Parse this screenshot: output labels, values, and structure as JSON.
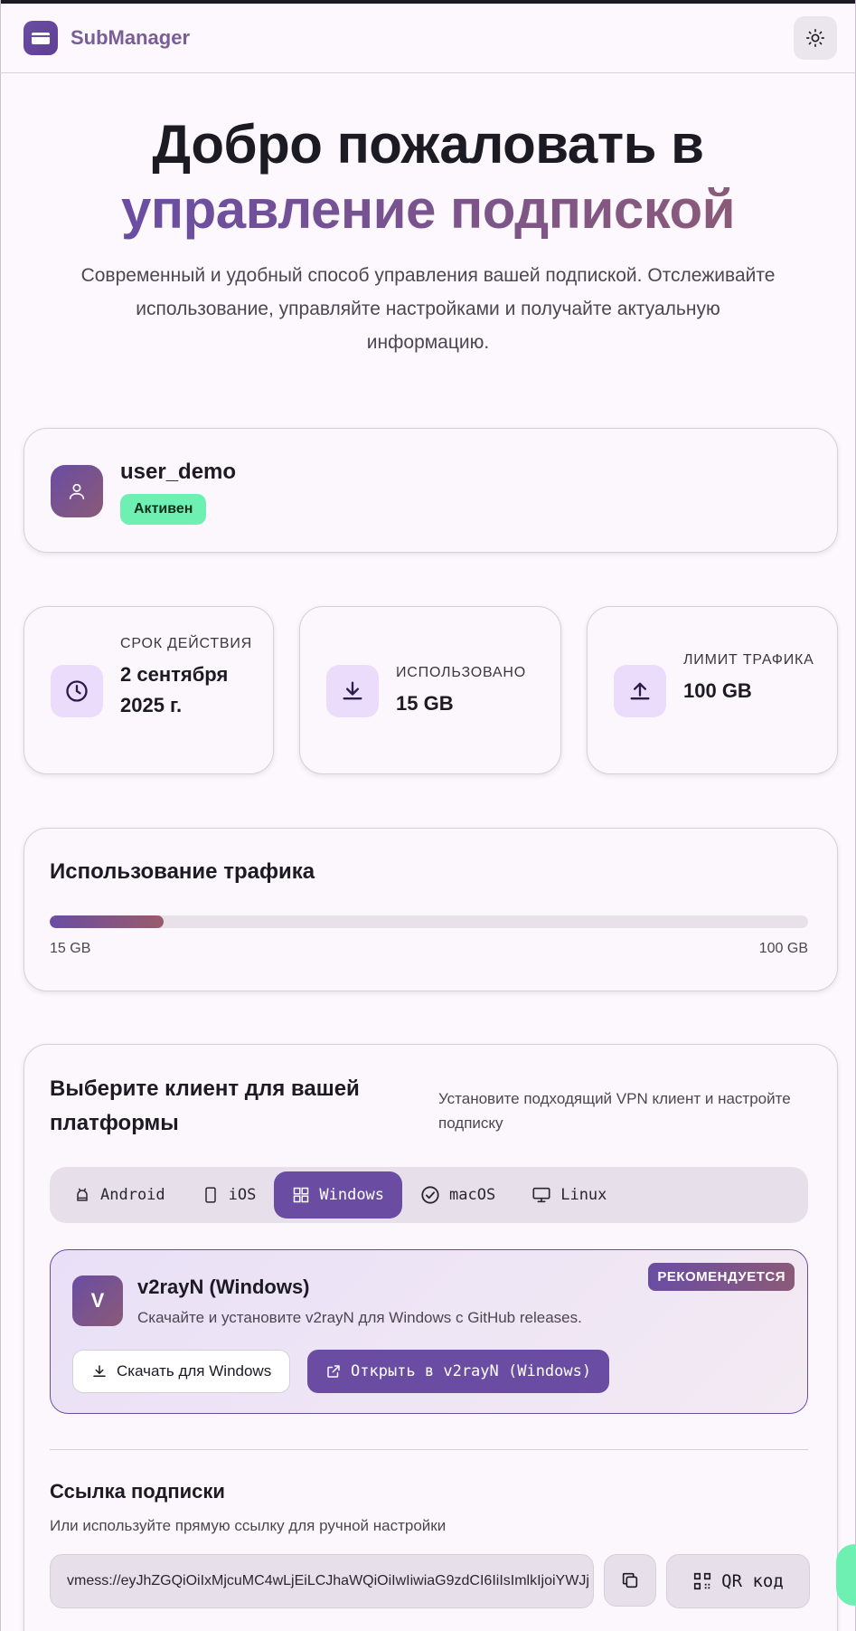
{
  "header": {
    "brand": "SubManager",
    "icons": {
      "logo": "card-icon",
      "theme": "sun-icon"
    }
  },
  "hero": {
    "title_line1": "Добро пожаловать в",
    "title_line2": "управление подпиской",
    "subtitle": "Современный и удобный способ управления вашей подпиской. Отслеживайте использование, управляйте настройками и получайте актуальную информацию."
  },
  "user": {
    "username": "user_demo",
    "status": "Активен",
    "status_color": "#6ff0b3"
  },
  "stats": [
    {
      "label": "Срок действия",
      "value": "2 сентября 2025 г.",
      "icon": "clock-icon"
    },
    {
      "label": "Использовано",
      "value": "15 GB",
      "icon": "download-icon"
    },
    {
      "label": "Лимит трафика",
      "value": "100 GB",
      "icon": "upload-icon"
    }
  ],
  "traffic": {
    "title": "Использование трафика",
    "used_label": "15 GB",
    "limit_label": "100 GB",
    "used_fraction": 0.15
  },
  "clients": {
    "title": "Выберите клиент для вашей платформы",
    "description": "Установите подходящий VPN клиент и настройте подписку",
    "tabs": [
      {
        "label": "Android",
        "icon": "android-icon",
        "active": false
      },
      {
        "label": "iOS",
        "icon": "phone-icon",
        "active": false
      },
      {
        "label": "Windows",
        "icon": "windows-icon",
        "active": true
      },
      {
        "label": "macOS",
        "icon": "apple-icon",
        "active": false
      },
      {
        "label": "Linux",
        "icon": "monitor-icon",
        "active": false
      }
    ],
    "selected": {
      "logo_letter": "V",
      "name": "v2rayN (Windows)",
      "description": "Скачайте и установите v2rayN для Windows с GitHub releases.",
      "badge": "РЕКОМЕНДУЕТСЯ",
      "download_label": "Скачать для Windows",
      "open_label": "Открыть в v2rayN (Windows)"
    }
  },
  "subscription_link": {
    "title": "Ссылка подписки",
    "description": "Или используйте прямую ссылку для ручной настройки",
    "value": "vmess://eyJhZGQiOiIxMjcuMC4wLjEiLCJhaWQiOiIwIiwiaG9zdCI6IiIsImlkIjoiYWJj",
    "qr_label": "QR код"
  },
  "colors": {
    "accent": "#6a4da3",
    "accent_secondary": "#8a5a78",
    "background": "#fcf8fd",
    "icon_tile": "#ebdcfb"
  }
}
